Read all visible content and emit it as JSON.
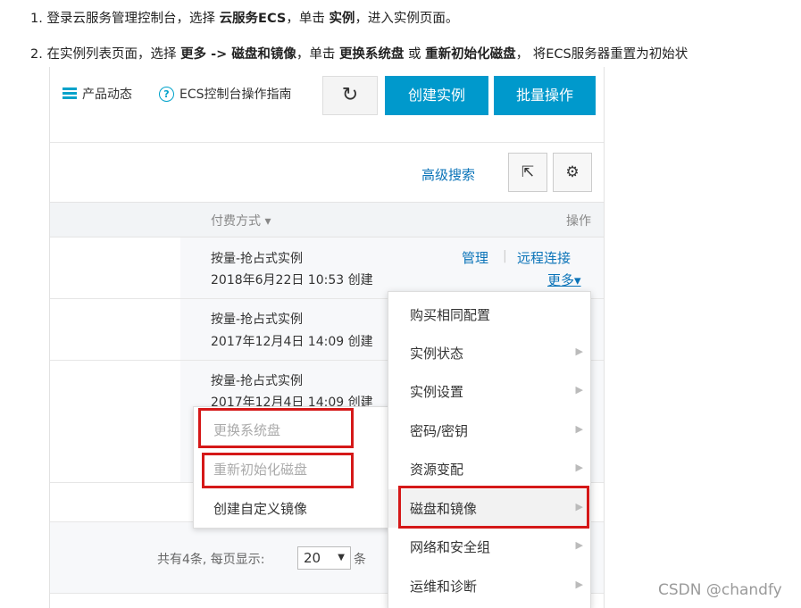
{
  "instructions": {
    "step1": {
      "number": "1.",
      "pre": "登录云服务管理控制台，选择",
      "bold1": "云服务ECS",
      "mid": "，单击",
      "bold2": "实例",
      "post": "，进入实例页面。"
    },
    "step2": {
      "number": "2.",
      "pre": "在实例列表页面，选择",
      "bold1": "更多 -> 磁盘和镜像",
      "mid": "，单击",
      "bold2": "更换系统盘",
      "or": "或",
      "bold3": "重新初始化磁盘",
      "post": "，  将ECS服务器重置为初始状"
    }
  },
  "topbar": {
    "product_news": "产品动态",
    "guide": "ECS控制台操作指南",
    "refresh_glyph": "↻",
    "create_instance": "创建实例",
    "batch_ops": "批量操作"
  },
  "toolbar": {
    "advanced_search": "高级搜索",
    "export_glyph": "⇱",
    "settings_glyph": "⚙"
  },
  "table": {
    "col_payment": "付费方式 ▾",
    "col_action": "操作",
    "rows": [
      {
        "type": "按量-抢占式实例",
        "date": "2018年6月22日 10:53 创建"
      },
      {
        "type": "按量-抢占式实例",
        "date": "2017年12月4日 14:09 创建"
      },
      {
        "type": "按量-抢占式实例",
        "date": "2017年12月4日 14:09 创建"
      }
    ],
    "ops": {
      "manage": "管理",
      "separator": "|",
      "remote": "远程连接",
      "more": "更多▾"
    }
  },
  "dropdown": {
    "items": [
      {
        "label": "购买相同配置",
        "arrow": ""
      },
      {
        "label": "实例状态",
        "arrow": "▶"
      },
      {
        "label": "实例设置",
        "arrow": "▶"
      },
      {
        "label": "密码/密钥",
        "arrow": "▶"
      },
      {
        "label": "资源变配",
        "arrow": "▶"
      },
      {
        "label": "磁盘和镜像",
        "arrow": "▶"
      },
      {
        "label": "网络和安全组",
        "arrow": "▶"
      },
      {
        "label": "运维和诊断",
        "arrow": "▶"
      }
    ]
  },
  "submenu": {
    "replace_disk": "更换系统盘",
    "reinit_disk": "重新初始化磁盘",
    "create_image": "创建自定义镜像"
  },
  "pager": {
    "summary": "共有4条, 每页显示:",
    "page_size": "20",
    "suffix": "条"
  },
  "colors": {
    "primary": "#0099cc",
    "link": "#0a73b8",
    "highlight": "#d51818"
  },
  "watermark": "CSDN @chandfy"
}
